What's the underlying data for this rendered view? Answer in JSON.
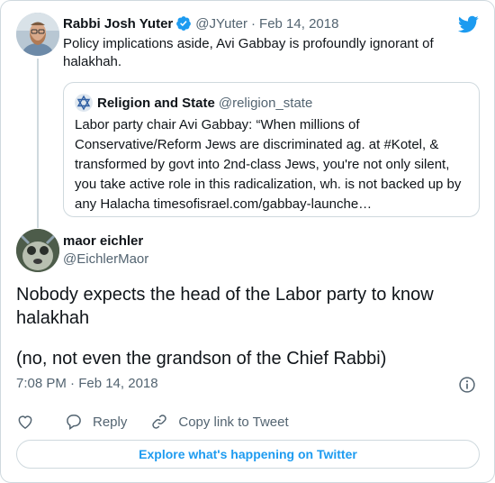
{
  "parent_tweet": {
    "name": "Rabbi Josh Yuter",
    "handle": "@JYuter",
    "separator": "·",
    "date": "Feb 14, 2018",
    "text": "Policy implications aside, Avi Gabbay is profoundly ignorant of halakhah.",
    "verified": true
  },
  "quoted_tweet": {
    "name": "Religion and State",
    "handle": "@religion_state",
    "text": "Labor party chair Avi Gabbay: “When millions of Conservative/Reform Jews are discriminated ag. at #Kotel, & transformed by govt into 2nd-class Jews, you're not only silent, you take active role in this radicalization, wh. is not backed up by any Halacha  timesofisrael.com/gabbay-launche…"
  },
  "main_tweet": {
    "name": "maor eichler",
    "handle": "@EichlerMaor",
    "text_line1": "Nobody expects the head of the Labor party to know halakhah",
    "text_line2": "(no, not even the grandson of the Chief Rabbi)",
    "timestamp": "7:08 PM · Feb 14, 2018"
  },
  "actions": {
    "reply_label": "Reply",
    "copy_link_label": "Copy link to Tweet"
  },
  "explore_label": "Explore what's happening on Twitter",
  "colors": {
    "brand_blue": "#1d9bf0",
    "text_secondary": "#536471",
    "border": "#cfd9de"
  },
  "icons": [
    "twitter-bird-icon",
    "verified-badge-icon",
    "info-icon",
    "heart-icon",
    "reply-icon",
    "link-icon",
    "star-of-david-icon"
  ]
}
